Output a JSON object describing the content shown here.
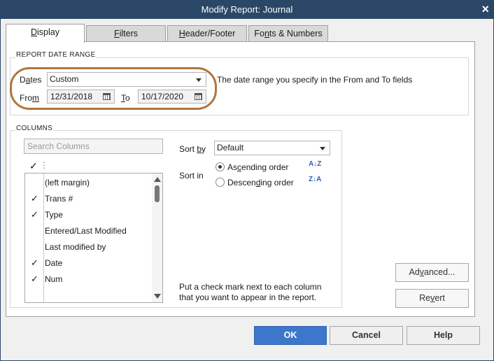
{
  "window": {
    "title": "Modify Report: Journal"
  },
  "tabs": [
    {
      "label_pre": "",
      "label_u": "D",
      "label_post": "isplay"
    },
    {
      "label_pre": "",
      "label_u": "F",
      "label_post": "ilters"
    },
    {
      "label_pre": "",
      "label_u": "H",
      "label_post": "eader/Footer"
    },
    {
      "label_pre": "Fo",
      "label_u": "n",
      "label_post": "ts & Numbers"
    }
  ],
  "report_date_range": {
    "heading": "REPORT DATE RANGE",
    "dates_label_pre": "D",
    "dates_label_u": "a",
    "dates_label_post": "tes",
    "dates_value": "Custom",
    "description": "The date range you specify in the From and To fields",
    "from_label_pre": "Fro",
    "from_label_u": "m",
    "from_value": "12/31/2018",
    "to_label_u": "T",
    "to_label_post": "o",
    "to_value": "10/17/2020"
  },
  "columns": {
    "heading": "COLUMNS",
    "search_placeholder": "Search Columns",
    "header_check": "✓",
    "header_dots": "⋮",
    "items": [
      {
        "check": "",
        "label": "(left margin)"
      },
      {
        "check": "✓",
        "label": "Trans #"
      },
      {
        "check": "✓",
        "label": "Type"
      },
      {
        "check": "",
        "label": "Entered/Last Modified"
      },
      {
        "check": "",
        "label": "Last modified by"
      },
      {
        "check": "✓",
        "label": "Date"
      },
      {
        "check": "✓",
        "label": "Num"
      }
    ],
    "sort_by_label_pre": "Sort ",
    "sort_by_label_u": "b",
    "sort_by_label_post": "y",
    "sort_by_value": "Default",
    "sort_in_label": "Sort in",
    "ascending_pre": "As",
    "ascending_u": "c",
    "ascending_post": "ending order",
    "descending_pre": "Descen",
    "descending_u": "d",
    "descending_post": "ing order",
    "ascending_icon": "A↓Z",
    "descending_icon": "Z↓A",
    "hint_line1": "Put a check mark next to each column",
    "hint_line2": "that you want to appear in the report."
  },
  "buttons": {
    "advanced_pre": "Ad",
    "advanced_u": "v",
    "advanced_post": "anced...",
    "revert_pre": "Re",
    "revert_u": "v",
    "revert_post": "ert",
    "ok": "OK",
    "cancel": "Cancel",
    "help": "Help",
    "close": "×"
  }
}
